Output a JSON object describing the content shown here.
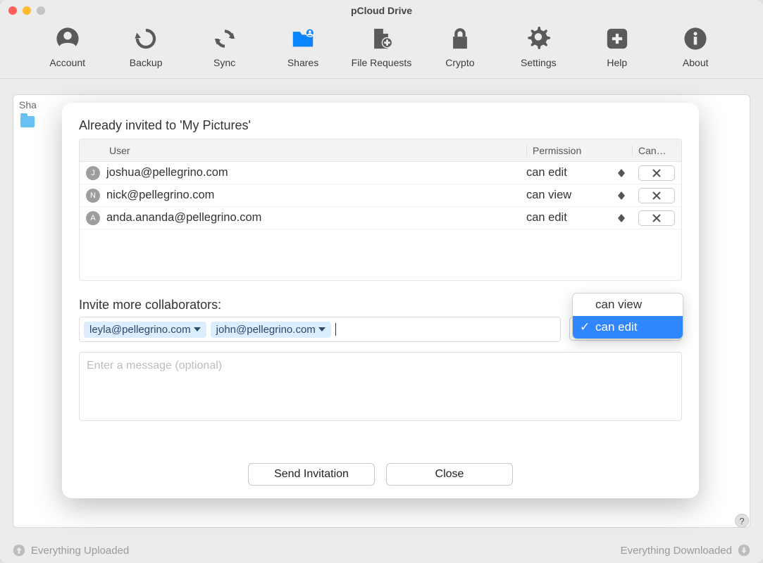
{
  "window": {
    "title": "pCloud Drive"
  },
  "toolbar": [
    {
      "key": "account",
      "label": "Account",
      "icon": "user"
    },
    {
      "key": "backup",
      "label": "Backup",
      "icon": "history"
    },
    {
      "key": "sync",
      "label": "Sync",
      "icon": "sync"
    },
    {
      "key": "shares",
      "label": "Shares",
      "icon": "folder-user",
      "active": true
    },
    {
      "key": "file-requests",
      "label": "File Requests",
      "icon": "file-plus"
    },
    {
      "key": "crypto",
      "label": "Crypto",
      "icon": "lock"
    },
    {
      "key": "settings",
      "label": "Settings",
      "icon": "gear"
    },
    {
      "key": "help",
      "label": "Help",
      "icon": "plus-square"
    },
    {
      "key": "about",
      "label": "About",
      "icon": "info"
    }
  ],
  "background": {
    "tab_label_partial": "Sha"
  },
  "dialog": {
    "title": "Already invited to 'My Pictures'",
    "columns": {
      "user": "User",
      "permission": "Permission",
      "cancel": "Can…"
    },
    "users": [
      {
        "avatar": "J",
        "email": "joshua@pellegrino.com",
        "permission": "can edit"
      },
      {
        "avatar": "N",
        "email": "nick@pellegrino.com",
        "permission": "can view"
      },
      {
        "avatar": "A",
        "email": "anda.ananda@pellegrino.com",
        "permission": "can edit"
      }
    ],
    "invite_label": "Invite more collaborators:",
    "chips": [
      {
        "email": "leyla@pellegrino.com"
      },
      {
        "email": "john@pellegrino.com"
      }
    ],
    "dropdown": {
      "options": [
        "can view",
        "can edit"
      ],
      "selected": "can edit"
    },
    "message_placeholder": "Enter a message (optional)",
    "buttons": {
      "send": "Send Invitation",
      "close": "Close"
    }
  },
  "status": {
    "left": "Everything Uploaded",
    "right": "Everything Downloaded"
  },
  "help_tip": "?"
}
